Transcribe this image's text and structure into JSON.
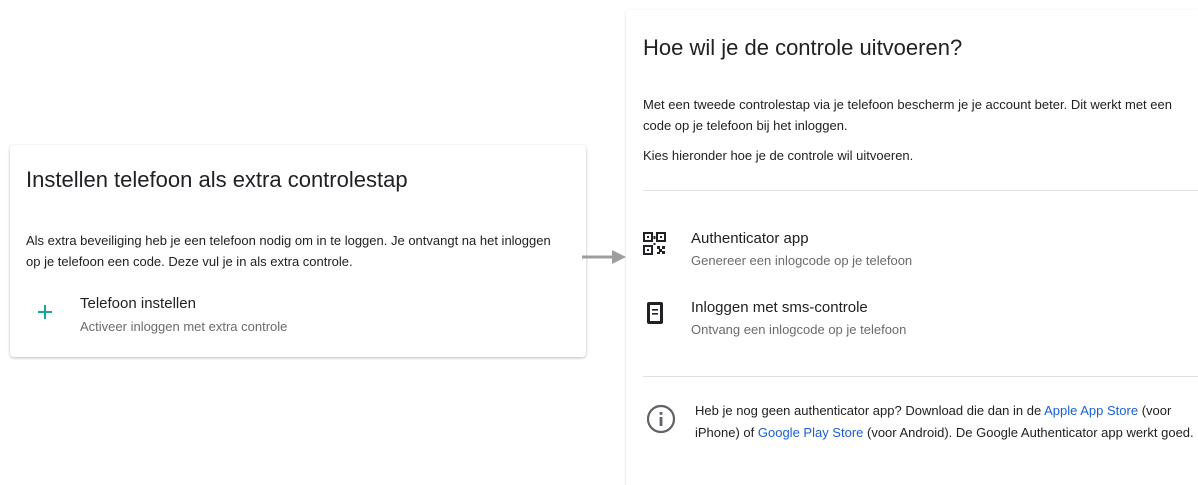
{
  "left_card": {
    "title": "Instellen telefoon als extra controlestap",
    "description": "Als extra beveiliging heb je een telefoon nodig om in te loggen. Je ontvangt na het inloggen op je telefoon een code. Deze vul je in als extra controle.",
    "action": {
      "icon": "plus-icon",
      "title": "Telefoon instellen",
      "subtitle": "Activeer inloggen met extra controle"
    }
  },
  "right_card": {
    "title": "Hoe wil je de controle uitvoeren?",
    "intro": "Met een tweede controlestap via je telefoon bescherm je je account beter. Dit werkt met een code op je telefoon bij het inloggen.",
    "choose": "Kies hieronder hoe je de controle wil uitvoeren.",
    "options": [
      {
        "icon": "qr-code-icon",
        "title": "Authenticator app",
        "subtitle": "Genereer een inlogcode op je telefoon"
      },
      {
        "icon": "phone-icon",
        "title": "Inloggen met sms-controle",
        "subtitle": "Ontvang een inlogcode op je telefoon"
      }
    ],
    "info": {
      "icon": "info-icon",
      "text_1": "Heb je nog geen authenticator app? Download die dan in de ",
      "link_1": "Apple App Store",
      "text_2": " (voor iPhone) of ",
      "link_2": "Google Play Store",
      "text_3": " (voor Android). De Google Authenticator app werkt goed."
    }
  },
  "colors": {
    "accent_plus": "#1aa59a",
    "link": "#1a5fd6",
    "arrow": "#9e9e9e",
    "secondary_text": "#6b6b6b"
  }
}
